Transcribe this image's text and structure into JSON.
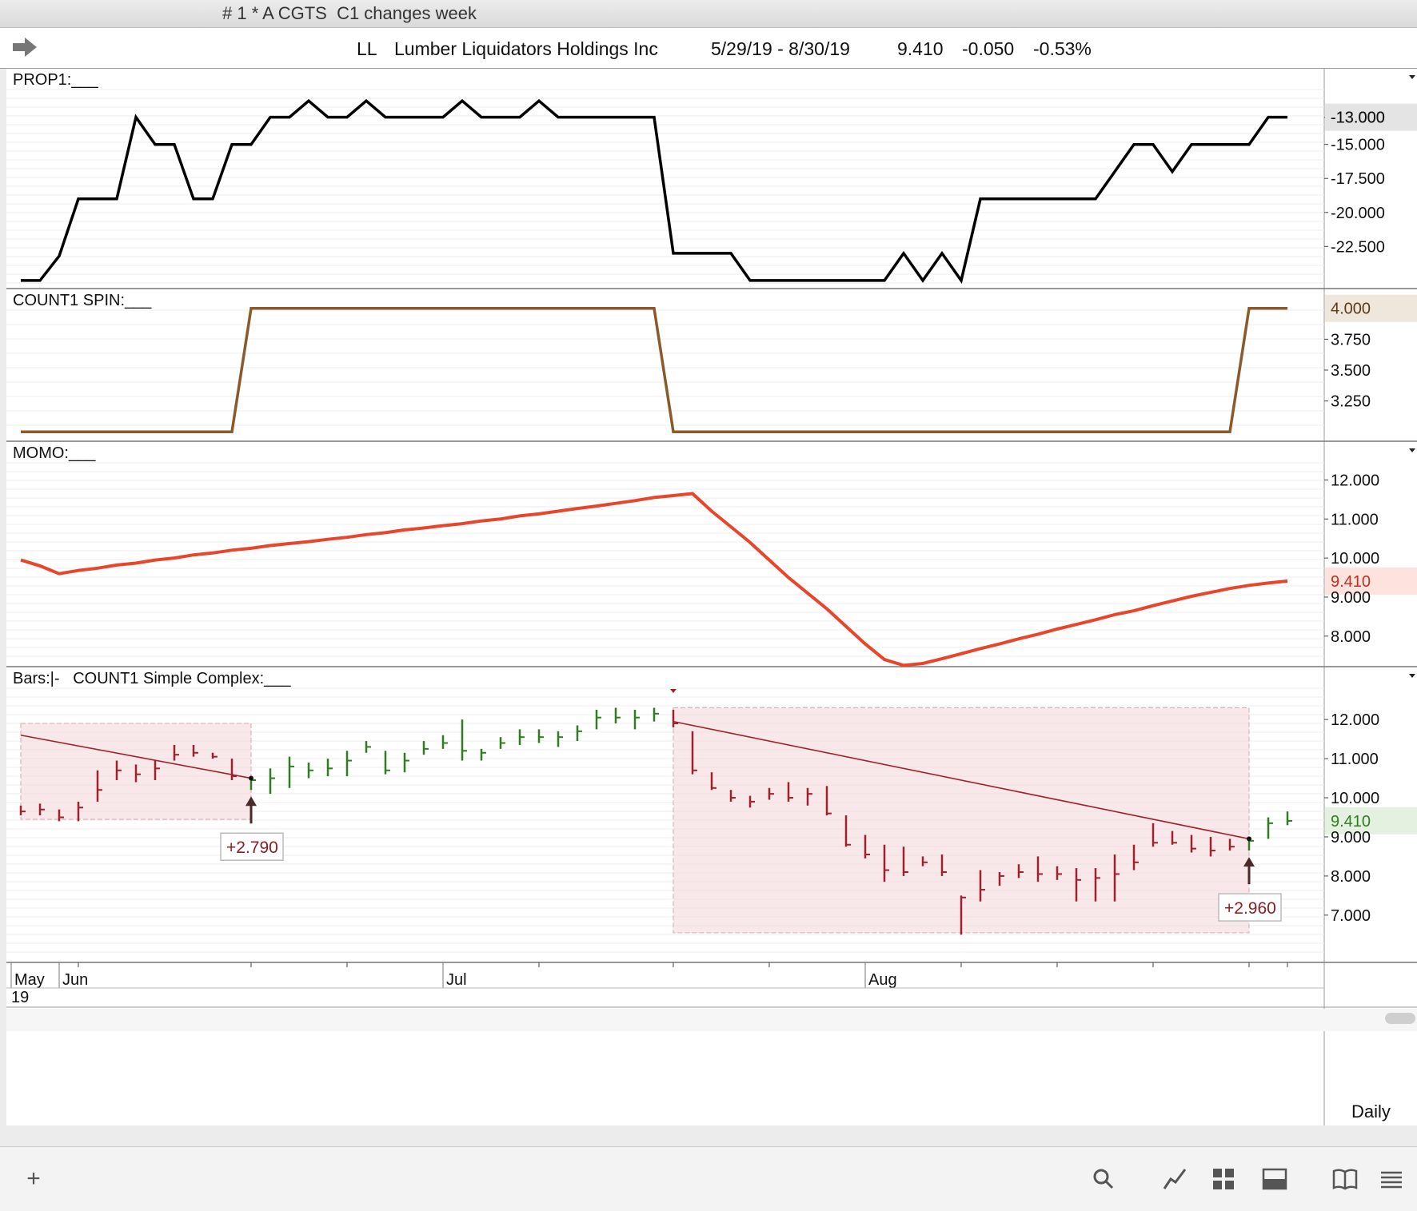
{
  "window": {
    "title": "# 1 * A CGTS  C1 changes week"
  },
  "header": {
    "symbol": "LL",
    "company": "Lumber Liquidators Holdings Inc",
    "date_range": "5/29/19 - 8/30/19",
    "last": "9.410",
    "change": "-0.050",
    "change_pct": "-0.53%"
  },
  "timeframe": "Daily",
  "x_axis": {
    "labels": [
      {
        "text": "May",
        "i": -0.5
      },
      {
        "text": "Jun",
        "i": 2
      },
      {
        "text": "Jul",
        "i": 22
      },
      {
        "text": "Aug",
        "i": 44
      }
    ],
    "year": "19",
    "ticks": [
      3,
      12,
      17,
      22,
      27,
      34,
      39,
      44,
      49,
      54,
      59,
      64,
      66
    ]
  },
  "colors": {
    "prop": "#000000",
    "spin": "#8b5a2b",
    "momo": "#e8452a",
    "up": "#2e7d1f",
    "down": "#a0212b",
    "trend": "#a0212b",
    "shade": "#f5dcdf"
  },
  "chart_data": [
    {
      "type": "line",
      "title": "PROP1:___",
      "y_ticks": [
        "-13.000",
        "-15.000",
        "-17.500",
        "-20.000",
        "-22.500"
      ],
      "y_tick_values": [
        -13,
        -15,
        -17.5,
        -20,
        -22.5
      ],
      "last_label": "-13.000",
      "ylim": [
        -25.3,
        -11.2
      ],
      "x": [
        0,
        1,
        2,
        3,
        4,
        5,
        6,
        7,
        8,
        9,
        10,
        11,
        12,
        13,
        14,
        15,
        16,
        17,
        18,
        19,
        20,
        21,
        22,
        23,
        24,
        25,
        26,
        27,
        28,
        29,
        30,
        31,
        32,
        33,
        34,
        35,
        36,
        37,
        38,
        39,
        40,
        41,
        42,
        43,
        44,
        45,
        46,
        47,
        48,
        49,
        50,
        51,
        52,
        53,
        54,
        55,
        56,
        57,
        58,
        59,
        60,
        61,
        62,
        63,
        64,
        65,
        66
      ],
      "values": [
        -25,
        -25,
        -23.2,
        -19,
        -19,
        -19,
        -13,
        -15,
        -15,
        -19,
        -19,
        -15,
        -15,
        -13,
        -13,
        -11.8,
        -13,
        -13,
        -11.8,
        -13,
        -13,
        -13,
        -13,
        -11.8,
        -13,
        -13,
        -13,
        -11.8,
        -13,
        -13,
        -13,
        -13,
        -13,
        -13,
        -23,
        -23,
        -23,
        -23,
        -25,
        -25,
        -25,
        -25,
        -25,
        -25,
        -25,
        -25,
        -23,
        -25,
        -23,
        -25,
        -19,
        -19,
        -19,
        -19,
        -19,
        -19,
        -19,
        -17,
        -15,
        -15,
        -17,
        -15,
        -15,
        -15,
        -15,
        -13,
        -13
      ]
    },
    {
      "type": "line",
      "title": "COUNT1 SPIN:___",
      "y_ticks": [
        "3.750",
        "3.500",
        "3.250"
      ],
      "y_tick_values": [
        3.75,
        3.5,
        3.25
      ],
      "last_label": "4.000",
      "ylim": [
        2.95,
        4.05
      ],
      "x": [
        0,
        11,
        12,
        33,
        34,
        63,
        64,
        66
      ],
      "values": [
        3,
        3,
        4,
        4,
        3,
        3,
        4,
        4
      ]
    },
    {
      "type": "line",
      "title": "MOMO:___",
      "y_ticks": [
        "12.000",
        "11.000",
        "10.000",
        "9.000",
        "8.000"
      ],
      "y_tick_values": [
        12,
        11,
        10,
        9,
        8
      ],
      "last_label": "9.410",
      "ylim": [
        7.3,
        12.5
      ],
      "x": [
        0,
        1,
        2,
        3,
        4,
        5,
        6,
        7,
        8,
        9,
        10,
        11,
        12,
        13,
        14,
        15,
        16,
        17,
        18,
        19,
        20,
        21,
        22,
        23,
        24,
        25,
        26,
        27,
        28,
        29,
        30,
        31,
        32,
        33,
        34,
        35,
        36,
        37,
        38,
        39,
        40,
        41,
        42,
        43,
        44,
        45,
        46,
        47,
        48,
        49,
        50,
        51,
        52,
        53,
        54,
        55,
        56,
        57,
        58,
        59,
        60,
        61,
        62,
        63,
        64,
        65,
        66
      ],
      "values": [
        9.95,
        9.8,
        9.6,
        9.68,
        9.74,
        9.82,
        9.87,
        9.95,
        10,
        10.08,
        10.13,
        10.2,
        10.25,
        10.32,
        10.37,
        10.42,
        10.48,
        10.53,
        10.6,
        10.65,
        10.72,
        10.77,
        10.83,
        10.88,
        10.95,
        11,
        11.08,
        11.13,
        11.2,
        11.27,
        11.33,
        11.4,
        11.47,
        11.55,
        11.6,
        11.65,
        11.2,
        10.8,
        10.4,
        9.95,
        9.5,
        9.1,
        8.7,
        8.25,
        7.8,
        7.4,
        7.25,
        7.3,
        7.42,
        7.55,
        7.68,
        7.8,
        7.93,
        8.05,
        8.18,
        8.3,
        8.42,
        8.55,
        8.65,
        8.78,
        8.9,
        9.02,
        9.12,
        9.22,
        9.3,
        9.36,
        9.41
      ]
    },
    {
      "type": "ohlc",
      "title": "Bars:|-   COUNT1 Simple Complex:___",
      "y_ticks": [
        "12.000",
        "11.000",
        "10.000",
        "9.000",
        "8.000",
        "7.000"
      ],
      "y_tick_values": [
        12,
        11,
        10,
        9,
        8,
        7
      ],
      "last_label": "9.410",
      "ylim": [
        6.2,
        12.8
      ],
      "bars": [
        {
          "h": 9.8,
          "l": 9.55,
          "c": 9.65,
          "u": false
        },
        {
          "h": 9.85,
          "l": 9.55,
          "c": 9.7,
          "u": false
        },
        {
          "h": 9.7,
          "l": 9.4,
          "c": 9.5,
          "u": false
        },
        {
          "h": 9.9,
          "l": 9.4,
          "c": 9.75,
          "u": false
        },
        {
          "h": 10.7,
          "l": 9.9,
          "c": 10.2,
          "u": false
        },
        {
          "h": 10.95,
          "l": 10.45,
          "c": 10.7,
          "u": false
        },
        {
          "h": 10.85,
          "l": 10.4,
          "c": 10.6,
          "u": false
        },
        {
          "h": 10.95,
          "l": 10.45,
          "c": 10.75,
          "u": false
        },
        {
          "h": 11.35,
          "l": 10.95,
          "c": 11.1,
          "u": false
        },
        {
          "h": 11.35,
          "l": 11.05,
          "c": 11.15,
          "u": false
        },
        {
          "h": 11.15,
          "l": 11.0,
          "c": 11.05,
          "u": false
        },
        {
          "h": 11.0,
          "l": 10.45,
          "c": 10.55,
          "u": false
        },
        {
          "h": 10.55,
          "l": 10.2,
          "c": 10.45,
          "u": true
        },
        {
          "h": 10.75,
          "l": 10.1,
          "c": 10.5,
          "u": true
        },
        {
          "h": 11.05,
          "l": 10.25,
          "c": 10.8,
          "u": true
        },
        {
          "h": 10.9,
          "l": 10.5,
          "c": 10.7,
          "u": true
        },
        {
          "h": 11.0,
          "l": 10.55,
          "c": 10.75,
          "u": true
        },
        {
          "h": 11.2,
          "l": 10.55,
          "c": 10.95,
          "u": true
        },
        {
          "h": 11.45,
          "l": 11.15,
          "c": 11.3,
          "u": true
        },
        {
          "h": 11.2,
          "l": 10.6,
          "c": 10.7,
          "u": true
        },
        {
          "h": 11.15,
          "l": 10.65,
          "c": 10.95,
          "u": true
        },
        {
          "h": 11.45,
          "l": 11.1,
          "c": 11.25,
          "u": true
        },
        {
          "h": 11.6,
          "l": 11.25,
          "c": 11.4,
          "u": true
        },
        {
          "h": 12.0,
          "l": 10.95,
          "c": 11.2,
          "u": true
        },
        {
          "h": 11.25,
          "l": 10.95,
          "c": 11.15,
          "u": true
        },
        {
          "h": 11.55,
          "l": 11.25,
          "c": 11.4,
          "u": true
        },
        {
          "h": 11.75,
          "l": 11.35,
          "c": 11.55,
          "u": true
        },
        {
          "h": 11.75,
          "l": 11.4,
          "c": 11.55,
          "u": true
        },
        {
          "h": 11.7,
          "l": 11.3,
          "c": 11.55,
          "u": true
        },
        {
          "h": 11.85,
          "l": 11.45,
          "c": 11.7,
          "u": true
        },
        {
          "h": 12.25,
          "l": 11.75,
          "c": 12.05,
          "u": true
        },
        {
          "h": 12.3,
          "l": 11.9,
          "c": 12.05,
          "u": true
        },
        {
          "h": 12.25,
          "l": 11.75,
          "c": 12.05,
          "u": true
        },
        {
          "h": 12.3,
          "l": 11.95,
          "c": 12.15,
          "u": true
        },
        {
          "h": 12.25,
          "l": 11.8,
          "c": 11.9,
          "u": false
        },
        {
          "h": 11.7,
          "l": 10.6,
          "c": 10.7,
          "u": false
        },
        {
          "h": 10.65,
          "l": 10.2,
          "c": 10.25,
          "u": false
        },
        {
          "h": 10.2,
          "l": 9.9,
          "c": 10.0,
          "u": false
        },
        {
          "h": 10.05,
          "l": 9.75,
          "c": 9.9,
          "u": false
        },
        {
          "h": 10.25,
          "l": 9.95,
          "c": 10.1,
          "u": false
        },
        {
          "h": 10.4,
          "l": 9.9,
          "c": 10.0,
          "u": false
        },
        {
          "h": 10.25,
          "l": 9.8,
          "c": 10.1,
          "u": false
        },
        {
          "h": 10.3,
          "l": 9.55,
          "c": 9.6,
          "u": false
        },
        {
          "h": 9.55,
          "l": 8.75,
          "c": 8.8,
          "u": false
        },
        {
          "h": 9.05,
          "l": 8.45,
          "c": 8.55,
          "u": false
        },
        {
          "h": 8.8,
          "l": 7.85,
          "c": 8.15,
          "u": false
        },
        {
          "h": 8.75,
          "l": 8.0,
          "c": 8.1,
          "u": false
        },
        {
          "h": 8.5,
          "l": 8.25,
          "c": 8.35,
          "u": false
        },
        {
          "h": 8.55,
          "l": 8.0,
          "c": 8.1,
          "u": false
        },
        {
          "h": 7.5,
          "l": 6.5,
          "c": 7.45,
          "u": false
        },
        {
          "h": 8.15,
          "l": 7.35,
          "c": 7.65,
          "u": false
        },
        {
          "h": 8.1,
          "l": 7.75,
          "c": 8.0,
          "u": false
        },
        {
          "h": 8.3,
          "l": 7.95,
          "c": 8.1,
          "u": false
        },
        {
          "h": 8.5,
          "l": 7.85,
          "c": 8.05,
          "u": false
        },
        {
          "h": 8.25,
          "l": 7.9,
          "c": 8.05,
          "u": false
        },
        {
          "h": 8.2,
          "l": 7.35,
          "c": 7.9,
          "u": false
        },
        {
          "h": 8.2,
          "l": 7.35,
          "c": 7.95,
          "u": false
        },
        {
          "h": 8.55,
          "l": 7.35,
          "c": 8.05,
          "u": false
        },
        {
          "h": 8.8,
          "l": 8.15,
          "c": 8.35,
          "u": false
        },
        {
          "h": 9.35,
          "l": 8.75,
          "c": 8.85,
          "u": false
        },
        {
          "h": 9.15,
          "l": 8.8,
          "c": 8.85,
          "u": false
        },
        {
          "h": 9.05,
          "l": 8.6,
          "c": 8.7,
          "u": false
        },
        {
          "h": 9.0,
          "l": 8.5,
          "c": 8.65,
          "u": false
        },
        {
          "h": 8.95,
          "l": 8.65,
          "c": 8.75,
          "u": false
        },
        {
          "h": 9.0,
          "l": 8.65,
          "c": 8.9,
          "u": true
        },
        {
          "h": 9.5,
          "l": 8.95,
          "c": 9.35,
          "u": true
        },
        {
          "h": 9.65,
          "l": 9.3,
          "c": 9.41,
          "u": true
        }
      ],
      "boxes": [
        {
          "x0": 0,
          "x1": 12,
          "hi": 11.9,
          "lo": 9.45
        },
        {
          "x0": 34,
          "x1": 64,
          "hi": 12.3,
          "lo": 6.55
        }
      ],
      "trendlines": [
        {
          "x0": 0,
          "v0": 11.6,
          "x1": 12,
          "v1": 10.5
        },
        {
          "x0": 34,
          "v0": 11.95,
          "x1": 64,
          "v1": 8.95
        }
      ],
      "signals": [
        {
          "i": 12,
          "label": "+2.790"
        },
        {
          "i": 64,
          "label": "+2.960"
        }
      ]
    }
  ]
}
